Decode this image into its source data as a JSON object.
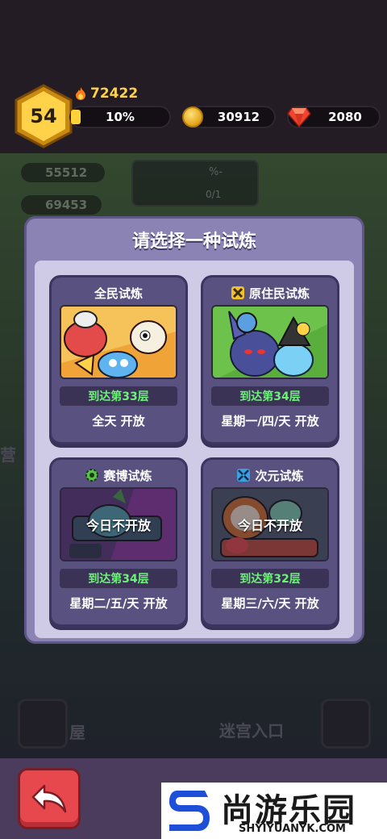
{
  "hud": {
    "level": "54",
    "power": "72422",
    "exp_percent_label": "10%",
    "exp_fraction": 0.1,
    "coins": "30912",
    "gems": "2080"
  },
  "background": {
    "chip1": "55512",
    "chip2": "69453",
    "slot_ratio": "0/1",
    "slot_percent": "%-",
    "side_text": "营",
    "bottom_left_text": "屋",
    "maze_entry": "迷宫入口"
  },
  "modal": {
    "title": "请选择一种试炼",
    "cards": [
      {
        "name": "全民试炼",
        "requirement": "到达第33层",
        "schedule": "全天 开放",
        "locked_text": "",
        "icon": ""
      },
      {
        "name": "原住民试炼",
        "requirement": "到达第34层",
        "schedule": "星期一/四/天 开放",
        "locked_text": "",
        "icon": "crossed-bones-icon"
      },
      {
        "name": "赛博试炼",
        "requirement": "到达第34层",
        "schedule": "星期二/五/天 开放",
        "locked_text": "今日不开放",
        "icon": "gear-icon"
      },
      {
        "name": "次元试炼",
        "requirement": "到达第32层",
        "schedule": "星期三/六/天 开放",
        "locked_text": "今日不开放",
        "icon": "portal-icon"
      }
    ]
  },
  "brand": {
    "name": "尚游乐园",
    "url": "SHYIYUANYK.COM"
  },
  "colors": {
    "requirement_green": "#6ef07a",
    "back_button": "#e6484e",
    "modal_frame": "#8a83b4"
  }
}
